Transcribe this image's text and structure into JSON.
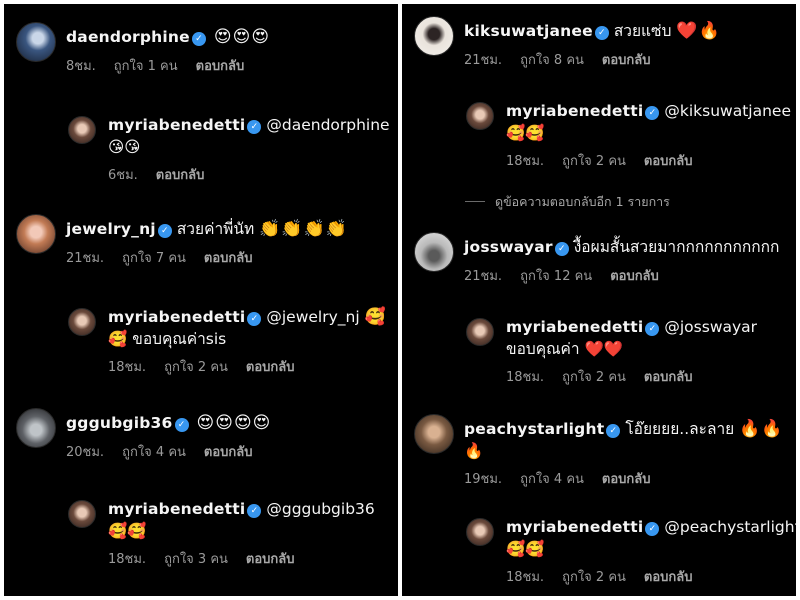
{
  "left": [
    {
      "user": "daendorphine",
      "text": "",
      "emojis": "😍😍😍",
      "time": "8ชม.",
      "likes": "ถูกใจ 1 คน",
      "reply": "ตอบกลับ",
      "avatar": "av-daen"
    },
    {
      "user": "myriabenedetti",
      "text": "@daendorphine",
      "line2": "😘😘",
      "time": "6ชม.",
      "likes": "",
      "reply": "ตอบกลับ",
      "avatar": "av-myria"
    },
    {
      "user": "jewelry_nj",
      "text": "สวยค่าพี่นัท",
      "emojis": "👏👏👏👏",
      "time": "21ชม.",
      "likes": "ถูกใจ 7 คน",
      "reply": "ตอบกลับ",
      "avatar": "av-jewel"
    },
    {
      "user": "myriabenedetti",
      "text": "@jewelry_nj",
      "emojis": "🥰",
      "line2": "🥰 ขอบคุณค่าsis",
      "time": "18ชม.",
      "likes": "ถูกใจ 2 คน",
      "reply": "ตอบกลับ",
      "avatar": "av-myria"
    },
    {
      "user": "gggubgib36",
      "text": "",
      "emojis": "😍😍😍😍",
      "time": "20ชม.",
      "likes": "ถูกใจ 4 คน",
      "reply": "ตอบกลับ",
      "avatar": "av-ggg"
    },
    {
      "user": "myriabenedetti",
      "text": "@gggubgib36",
      "line2": "🥰🥰",
      "time": "18ชม.",
      "likes": "ถูกใจ 3 คน",
      "reply": "ตอบกลับ",
      "avatar": "av-myria"
    }
  ],
  "right": [
    {
      "user": "kiksuwatjanee",
      "text": "สวยแซ่บ",
      "emojis": "❤️🔥",
      "time": "21ชม.",
      "likes": "ถูกใจ 8 คน",
      "reply": "ตอบกลับ",
      "avatar": "av-kik"
    },
    {
      "user": "myriabenedetti",
      "text": "@kiksuwatjanee",
      "line2": "🥰🥰",
      "time": "18ชม.",
      "likes": "ถูกใจ 2 คน",
      "reply": "ตอบกลับ",
      "avatar": "av-myria"
    },
    {
      "user": "josswayar",
      "text": "งื้อผมสั้นสวยมากกกกกกกกกกก",
      "time": "21ชม.",
      "likes": "ถูกใจ 12 คน",
      "reply": "ตอบกลับ",
      "avatar": "av-joss"
    },
    {
      "user": "myriabenedetti",
      "text": "@josswayar",
      "line2": "ขอบคุณค่า ❤️❤️",
      "time": "18ชม.",
      "likes": "ถูกใจ 2 คน",
      "reply": "ตอบกลับ",
      "avatar": "av-myria"
    },
    {
      "user": "peachystarlight",
      "text": "โอ๊ยยยย..ละลาย",
      "emojis": "🔥🔥",
      "line2": "🔥",
      "time": "19ชม.",
      "likes": "ถูกใจ 4 คน",
      "reply": "ตอบกลับ",
      "avatar": "av-peachy"
    },
    {
      "user": "myriabenedetti",
      "text": "@peachystarlight",
      "line2": "🥰🥰",
      "time": "18ชม.",
      "likes": "ถูกใจ 2 คน",
      "reply": "ตอบกลับ",
      "avatar": "av-myria"
    }
  ],
  "view_more": "ดูข้อความตอบกลับอีก 1 รายการ",
  "verified_glyph": "✓",
  "colors": {
    "background": "#000000",
    "text": "#f5f5f5",
    "meta": "#9a9a9a",
    "verified": "#3897f0"
  }
}
